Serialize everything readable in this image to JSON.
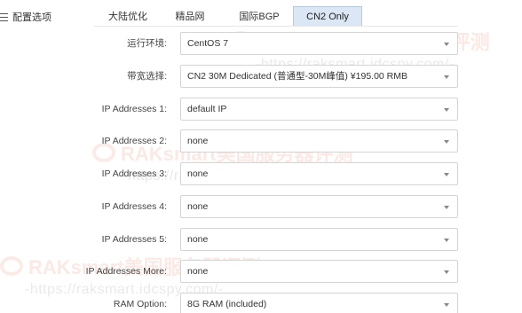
{
  "section": {
    "title": "配置选项",
    "icon": "list-icon"
  },
  "tabs": [
    {
      "label": "大陆优化",
      "active": false
    },
    {
      "label": "精品网",
      "active": false
    },
    {
      "label": "国际BGP",
      "active": false
    },
    {
      "label": "CN2 Only",
      "active": true
    }
  ],
  "form": [
    {
      "label": "运行环境:",
      "value": "CentOS 7"
    },
    {
      "label": "带宽选择:",
      "value": "CN2 30M Dedicated (普通型-30M峰值) ¥195.00 RMB"
    },
    {
      "label": "IP Addresses 1:",
      "value": "default IP"
    },
    {
      "label": "IP Addresses 2:",
      "value": "none"
    },
    {
      "label": "IP Addresses 3:",
      "value": "none"
    },
    {
      "label": "IP Addresses 4:",
      "value": "none"
    },
    {
      "label": "IP Addresses 5:",
      "value": "none"
    },
    {
      "label": "IP Addresses More:",
      "value": "none"
    },
    {
      "label": "RAM Option:",
      "value": "8G RAM (included)"
    }
  ],
  "watermark": {
    "brand": "RAKsmart美国服务器评测",
    "url": "-https://raksmart.idcspy.com/-"
  }
}
